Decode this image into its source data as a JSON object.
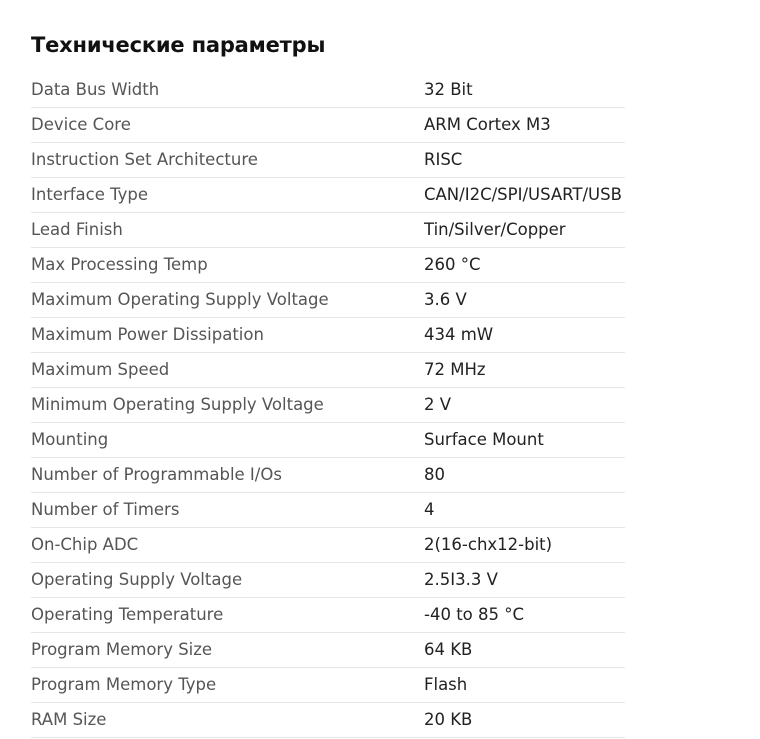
{
  "title": "Технические параметры",
  "specs": [
    {
      "name": "Data Bus Width",
      "value": "32 Bit"
    },
    {
      "name": "Device Core",
      "value": "ARM Cortex M3"
    },
    {
      "name": "Instruction Set Architecture",
      "value": "RISC"
    },
    {
      "name": "Interface Type",
      "value": "CAN/I2C/SPI/USART/USB"
    },
    {
      "name": "Lead Finish",
      "value": "Tin/Silver/Copper"
    },
    {
      "name": "Max Processing Temp",
      "value": "260 °C"
    },
    {
      "name": "Maximum Operating Supply Voltage",
      "value": "3.6 V"
    },
    {
      "name": "Maximum Power Dissipation",
      "value": "434 mW"
    },
    {
      "name": "Maximum Speed",
      "value": "72 MHz"
    },
    {
      "name": "Minimum Operating Supply Voltage",
      "value": "2 V"
    },
    {
      "name": "Mounting",
      "value": "Surface Mount"
    },
    {
      "name": "Number of Programmable I/Os",
      "value": "80"
    },
    {
      "name": "Number of Timers",
      "value": "4"
    },
    {
      "name": "On-Chip ADC",
      "value": "2(16-chx12-bit)"
    },
    {
      "name": "Operating Supply Voltage",
      "value": "2.5I3.3 V"
    },
    {
      "name": "Operating Temperature",
      "value": "-40 to 85 °C"
    },
    {
      "name": "Program Memory Size",
      "value": "64 KB"
    },
    {
      "name": "Program Memory Type",
      "value": "Flash"
    },
    {
      "name": "RAM Size",
      "value": "20 KB"
    }
  ]
}
